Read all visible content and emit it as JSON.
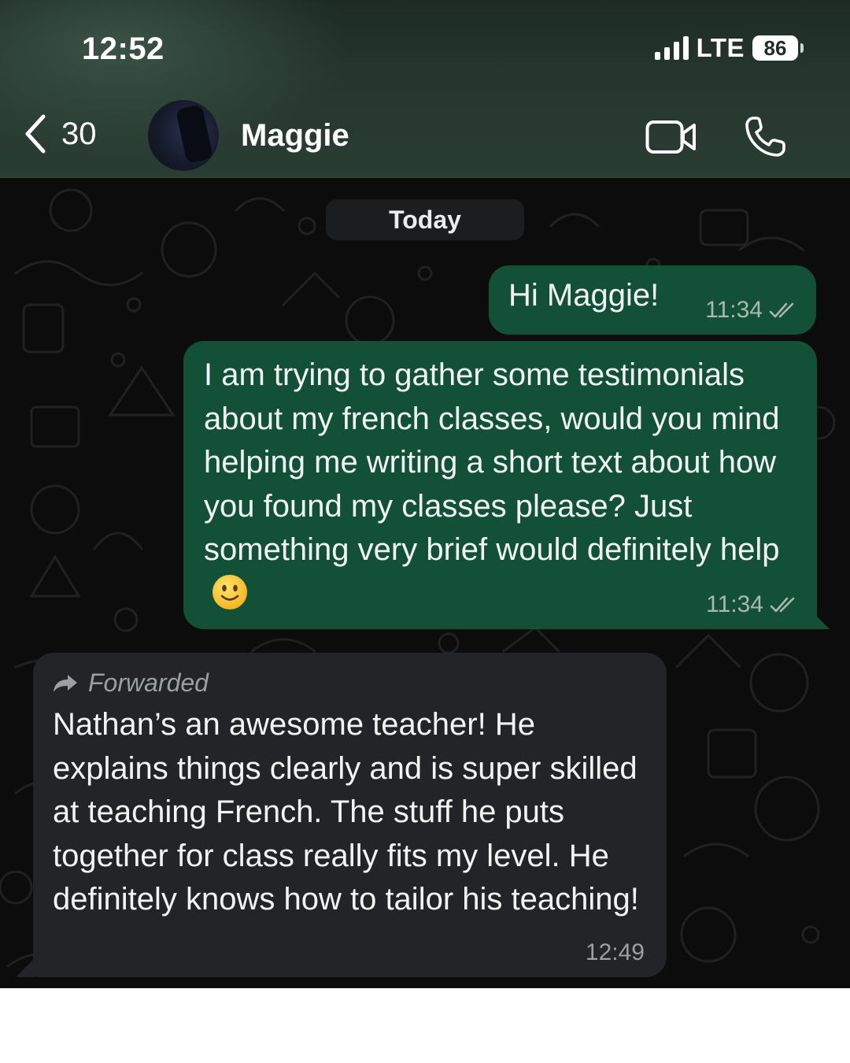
{
  "status_bar": {
    "time": "12:52",
    "network": "LTE",
    "battery": "86"
  },
  "header": {
    "back_count": "30",
    "contact_name": "Maggie",
    "icons": [
      "chevron-left-icon",
      "video-camera-icon",
      "phone-icon"
    ]
  },
  "chat": {
    "date_separator": "Today",
    "messages": [
      {
        "direction": "outgoing",
        "text": "Hi Maggie!",
        "time": "11:34",
        "status": "read"
      },
      {
        "direction": "outgoing",
        "text": "I am trying to gather some testimonials about my french classes, would you mind helping me writing a short text about how you found my classes please? Just something very brief would definitely help",
        "emoji": "slightly-smiling-face",
        "time": "11:34",
        "status": "read"
      },
      {
        "direction": "incoming",
        "forwarded_label": "Forwarded",
        "text": "Nathan’s an awesome teacher! He explains things clearly and is super skilled at teaching French. The stuff he puts together for class really fits my level. He definitely knows how to tailor his teaching!",
        "time": "12:49"
      }
    ]
  },
  "colors": {
    "outgoing_bubble": "#125038",
    "incoming_bubble": "#222427",
    "header_bg": "#26372e",
    "chat_bg": "#0c0c0c"
  }
}
